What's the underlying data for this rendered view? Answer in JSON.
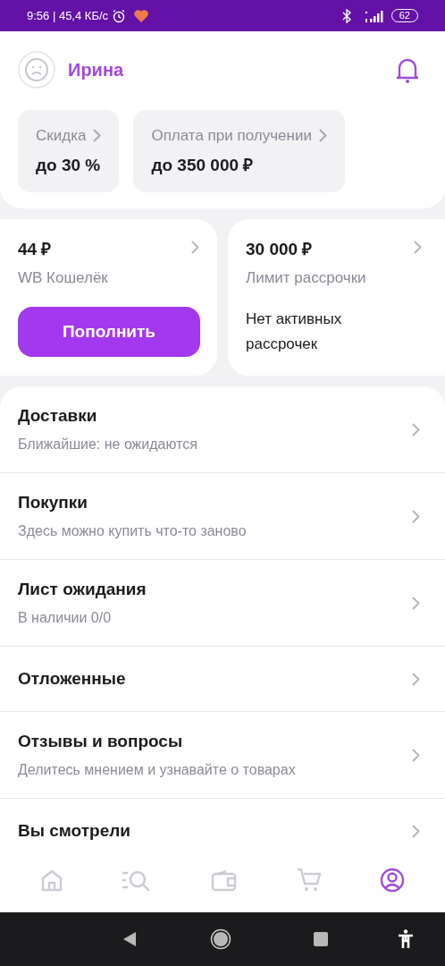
{
  "status_bar": {
    "time": "9:56 | 45,4 КБ/с",
    "battery": "62"
  },
  "profile": {
    "name": "Ирина"
  },
  "perks": [
    {
      "label": "Скидка",
      "value": "до 30 %"
    },
    {
      "label": "Оплата при получении",
      "value": "до 350 000 ₽"
    }
  ],
  "wallet": {
    "amount": "44 ₽",
    "label": "WB Кошелёк",
    "button": "Пополнить"
  },
  "installment": {
    "amount": "30 000 ₽",
    "label": "Лимит рассрочки",
    "note": "Нет активных рассрочек"
  },
  "menu": [
    {
      "title": "Доставки",
      "subtitle": "Ближайшие: не ожидаются"
    },
    {
      "title": "Покупки",
      "subtitle": "Здесь можно купить что-то заново"
    },
    {
      "title": "Лист ожидания",
      "subtitle": "В наличии 0/0"
    },
    {
      "title": "Отложенные"
    },
    {
      "title": "Отзывы и вопросы",
      "subtitle": "Делитесь мнением и узнавайте о товарах"
    },
    {
      "title": "Вы смотрели"
    }
  ],
  "nav": [
    {
      "kind": "home",
      "selected": false
    },
    {
      "kind": "catalog",
      "selected": false
    },
    {
      "kind": "wallet",
      "selected": false
    },
    {
      "kind": "cart",
      "selected": false
    },
    {
      "kind": "profile",
      "selected": true
    }
  ]
}
